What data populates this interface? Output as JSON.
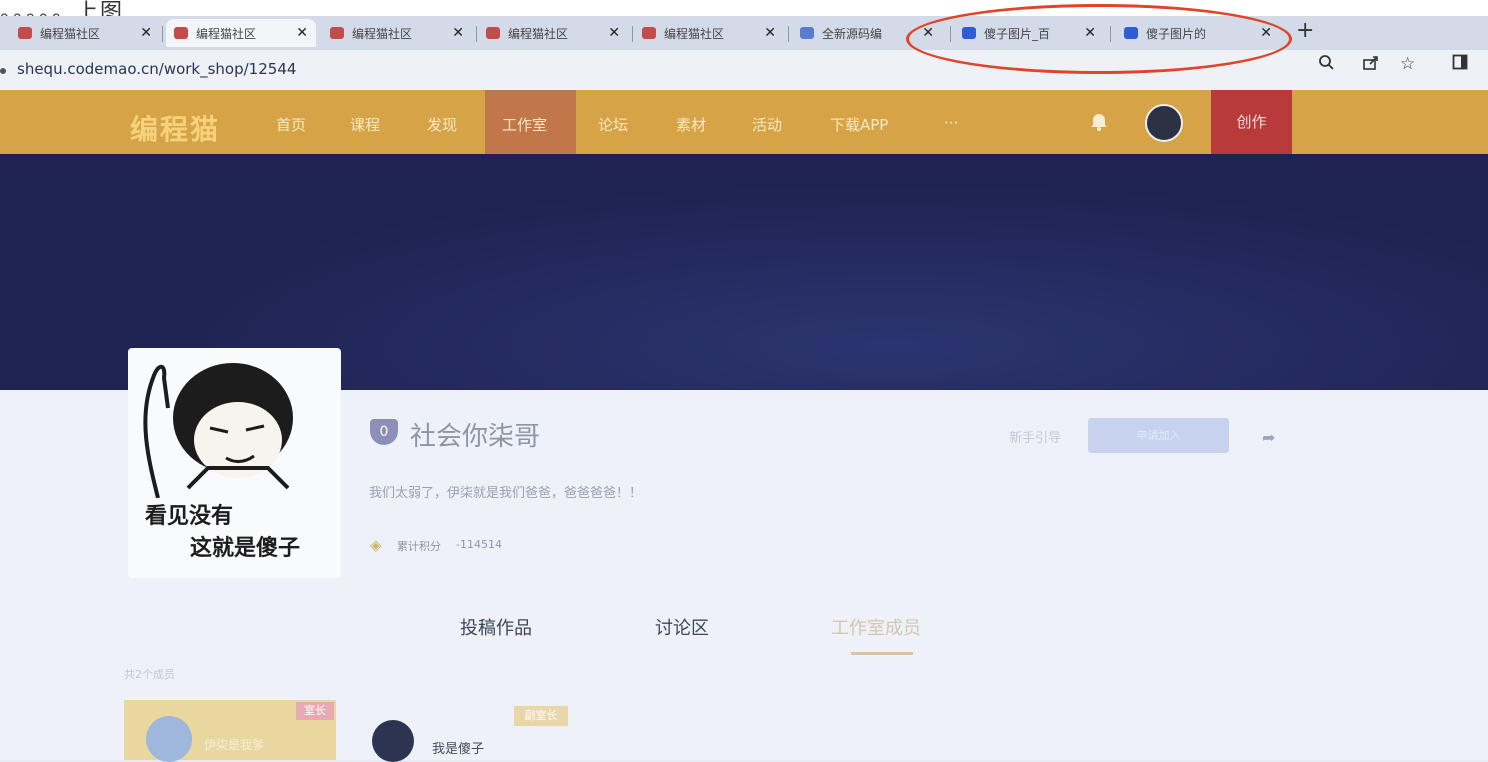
{
  "caption": "。。。。。上图",
  "browser": {
    "tabs": [
      {
        "label": "编程猫社区",
        "favicon_color": "#c24b4b",
        "active": false
      },
      {
        "label": "编程猫社区",
        "favicon_color": "#c24b4b",
        "active": true
      },
      {
        "label": "编程猫社区",
        "favicon_color": "#c24b4b",
        "active": false
      },
      {
        "label": "编程猫社区",
        "favicon_color": "#c24b4b",
        "active": false
      },
      {
        "label": "编程猫社区",
        "favicon_color": "#c24b4b",
        "active": false
      },
      {
        "label": "全新源码编",
        "favicon_color": "#5a7ccf",
        "active": false
      },
      {
        "label": "傻子图片_百",
        "favicon_color": "#2f5bd3",
        "active": false
      },
      {
        "label": "傻子图片的",
        "favicon_color": "#2f5bd3",
        "active": false
      }
    ],
    "tab_close": "✕",
    "new_tab": "+",
    "url": "shequ.codemao.cn/work_shop/12544",
    "toolbar_icons": [
      "zoom-icon",
      "share-icon",
      "star-icon",
      "sidebar-icon"
    ]
  },
  "site": {
    "logo": "编程猫",
    "nav": [
      "首页",
      "课程",
      "发现",
      "工作室",
      "论坛",
      "素材",
      "活动",
      "下载APP",
      "···"
    ],
    "active_nav": "工作室",
    "create": "创作"
  },
  "studio": {
    "avatar_caption_line1": "看见没有",
    "avatar_caption_line2": "这就是傻子",
    "level": "0",
    "name": "社会你柒哥",
    "description": "我们太弱了，伊柒就是我们爸爸，爸爸爸爸！！",
    "points_label": "累计积分",
    "points_value": "-114514",
    "guide": "新手引导",
    "apply": "申请加入"
  },
  "content_tabs": {
    "items": [
      "投稿作品",
      "讨论区",
      "工作室成员"
    ],
    "active": "工作室成员"
  },
  "members": {
    "count_text": "共2个成员",
    "owner": {
      "badge": "室长",
      "name": "伊柒是我爹"
    },
    "deputy": {
      "badge": "副室长",
      "name": "我是傻子"
    }
  },
  "colors": {
    "nav_bg": "#d6a447",
    "create_bg": "#b83a3a",
    "banner_bg": "#1e2352",
    "annotation": "#e0452a"
  }
}
